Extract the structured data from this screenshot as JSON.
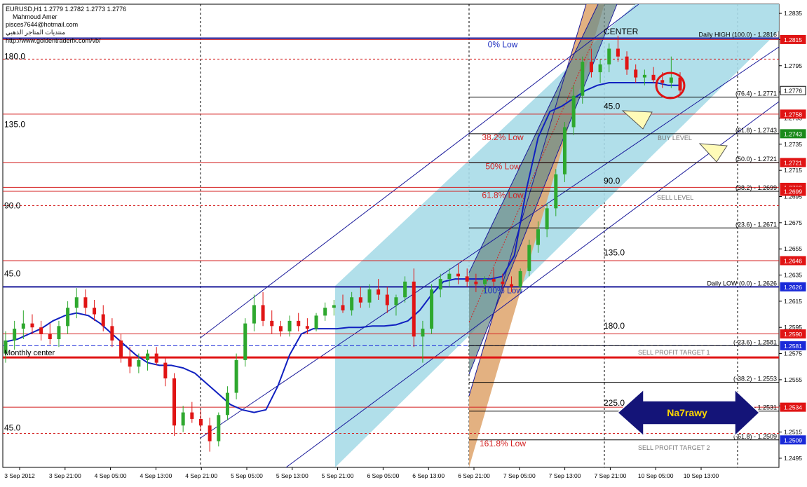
{
  "header": {
    "line1": "EURUSD,H1  1.2779 1.2782 1.2773 1.2776",
    "line2": "Mahmoud Amer",
    "line3": "pisces7644@hotmail.com",
    "line4": "منتديات المتاجر الذهبي",
    "line5": "http://www.goldentraderfx.com/vb/"
  },
  "colors": {
    "up": "#2ea82e",
    "down": "#e01414",
    "band": "#a9dbe8",
    "band_dark": "#6f8d8a",
    "band_orange": "#e0a873",
    "ma": "#1020c0",
    "red_line": "#d42020",
    "blue_line": "#1a1a9a",
    "arrow": "#141478"
  },
  "chart_data": {
    "type": "candlestick",
    "symbol": "EURUSD",
    "timeframe": "H1",
    "ylim": [
      1.2488,
      1.2842
    ],
    "y_ticks": [
      "1.2835",
      "1.2815",
      "1.2795",
      "1.2775",
      "1.2755",
      "1.2735",
      "1.2715",
      "1.2695",
      "1.2675",
      "1.2655",
      "1.2635",
      "1.2615",
      "1.2595",
      "1.2575",
      "1.2555",
      "1.2535",
      "1.2515",
      "1.2495"
    ],
    "x_ticks": [
      "3 Sep 2012",
      "3 Sep 21:00",
      "4 Sep 05:00",
      "4 Sep 13:00",
      "4 Sep 21:00",
      "5 Sep 05:00",
      "5 Sep 13:00",
      "5 Sep 21:00",
      "6 Sep 05:00",
      "6 Sep 13:00",
      "6 Sep 21:00",
      "7 Sep 05:00",
      "7 Sep 13:00",
      "7 Sep 21:00",
      "10 Sep 05:00",
      "10 Sep 13:00"
    ],
    "ohlc": [
      [
        1.2575,
        1.2592,
        1.2568,
        1.2585
      ],
      [
        1.2585,
        1.26,
        1.2578,
        1.2594
      ],
      [
        1.2594,
        1.2608,
        1.2586,
        1.2598
      ],
      [
        1.2598,
        1.2605,
        1.259,
        1.2595
      ],
      [
        1.2595,
        1.26,
        1.2585,
        1.259
      ],
      [
        1.259,
        1.2598,
        1.2582,
        1.2586
      ],
      [
        1.2586,
        1.26,
        1.258,
        1.2596
      ],
      [
        1.2596,
        1.2615,
        1.259,
        1.261
      ],
      [
        1.261,
        1.2625,
        1.2602,
        1.2618
      ],
      [
        1.2618,
        1.2624,
        1.2605,
        1.261
      ],
      [
        1.261,
        1.2616,
        1.26,
        1.2605
      ],
      [
        1.2605,
        1.2612,
        1.2592,
        1.2596
      ],
      [
        1.2596,
        1.2602,
        1.258,
        1.2585
      ],
      [
        1.2585,
        1.259,
        1.2568,
        1.2572
      ],
      [
        1.2572,
        1.258,
        1.256,
        1.2565
      ],
      [
        1.2565,
        1.2575,
        1.256,
        1.257
      ],
      [
        1.257,
        1.2578,
        1.2562,
        1.2575
      ],
      [
        1.2575,
        1.258,
        1.2566,
        1.2568
      ],
      [
        1.2568,
        1.2572,
        1.255,
        1.2556
      ],
      [
        1.2556,
        1.256,
        1.2512,
        1.252
      ],
      [
        1.252,
        1.2535,
        1.2515,
        1.253
      ],
      [
        1.253,
        1.2538,
        1.2522,
        1.2525
      ],
      [
        1.2525,
        1.2532,
        1.2516,
        1.252
      ],
      [
        1.252,
        1.2526,
        1.25,
        1.2508
      ],
      [
        1.2508,
        1.253,
        1.2504,
        1.2528
      ],
      [
        1.2528,
        1.255,
        1.2524,
        1.2545
      ],
      [
        1.2545,
        1.2575,
        1.254,
        1.257
      ],
      [
        1.257,
        1.2602,
        1.2565,
        1.2598
      ],
      [
        1.2598,
        1.262,
        1.2592,
        1.2612
      ],
      [
        1.2612,
        1.2622,
        1.2596,
        1.26
      ],
      [
        1.26,
        1.2608,
        1.259,
        1.2596
      ],
      [
        1.2596,
        1.26,
        1.2588,
        1.2592
      ],
      [
        1.2592,
        1.2604,
        1.2588,
        1.26
      ],
      [
        1.26,
        1.2606,
        1.2592,
        1.2596
      ],
      [
        1.2596,
        1.2602,
        1.259,
        1.2594
      ],
      [
        1.2594,
        1.2606,
        1.2592,
        1.2604
      ],
      [
        1.2604,
        1.2614,
        1.26,
        1.261
      ],
      [
        1.261,
        1.2616,
        1.2604,
        1.2612
      ],
      [
        1.2612,
        1.262,
        1.2606,
        1.2608
      ],
      [
        1.2608,
        1.2622,
        1.2604,
        1.2618
      ],
      [
        1.2618,
        1.2626,
        1.261,
        1.2614
      ],
      [
        1.2614,
        1.2628,
        1.261,
        1.2624
      ],
      [
        1.2624,
        1.2632,
        1.2616,
        1.262
      ],
      [
        1.262,
        1.2626,
        1.2606,
        1.2612
      ],
      [
        1.2612,
        1.262,
        1.2604,
        1.2618
      ],
      [
        1.2618,
        1.2634,
        1.2614,
        1.263
      ],
      [
        1.263,
        1.264,
        1.258,
        1.2588
      ],
      [
        1.2588,
        1.26,
        1.2568,
        1.2594
      ],
      [
        1.2594,
        1.2628,
        1.259,
        1.2624
      ],
      [
        1.2624,
        1.2636,
        1.2618,
        1.2632
      ],
      [
        1.2632,
        1.264,
        1.2626,
        1.2636
      ],
      [
        1.2636,
        1.2644,
        1.2628,
        1.2634
      ],
      [
        1.2634,
        1.264,
        1.2626,
        1.263
      ],
      [
        1.263,
        1.2636,
        1.2622,
        1.2628
      ],
      [
        1.2628,
        1.2634,
        1.2622,
        1.2632
      ],
      [
        1.2632,
        1.264,
        1.2626,
        1.263
      ],
      [
        1.263,
        1.2636,
        1.2624,
        1.2628
      ],
      [
        1.2628,
        1.2634,
        1.2622,
        1.2626
      ],
      [
        1.2626,
        1.264,
        1.2622,
        1.2638
      ],
      [
        1.2638,
        1.2662,
        1.2634,
        1.2658
      ],
      [
        1.2658,
        1.2676,
        1.2652,
        1.267
      ],
      [
        1.267,
        1.269,
        1.2664,
        1.2686
      ],
      [
        1.2686,
        1.2716,
        1.268,
        1.2712
      ],
      [
        1.2712,
        1.2752,
        1.2706,
        1.2748
      ],
      [
        1.2748,
        1.278,
        1.2742,
        1.2772
      ],
      [
        1.2772,
        1.2802,
        1.2766,
        1.2798
      ],
      [
        1.2798,
        1.2808,
        1.2786,
        1.279
      ],
      [
        1.279,
        1.28,
        1.2782,
        1.2796
      ],
      [
        1.2796,
        1.2812,
        1.279,
        1.2808
      ],
      [
        1.2808,
        1.2818,
        1.2798,
        1.2802
      ],
      [
        1.2802,
        1.2806,
        1.2788,
        1.2792
      ],
      [
        1.2792,
        1.2796,
        1.2782,
        1.2786
      ],
      [
        1.2786,
        1.2792,
        1.278,
        1.2788
      ],
      [
        1.2788,
        1.2794,
        1.2782,
        1.2784
      ],
      [
        1.2784,
        1.279,
        1.2778,
        1.2782
      ],
      [
        1.2782,
        1.2802,
        1.2778,
        1.2786
      ],
      [
        1.2786,
        1.279,
        1.2772,
        1.2776
      ]
    ],
    "ma_line": [
      1.2584,
      1.2586,
      1.259,
      1.2594,
      1.26,
      1.2604,
      1.2606,
      1.2604,
      1.2598,
      1.259,
      1.2582,
      1.2574,
      1.2568,
      1.2566,
      1.2566,
      1.2564,
      1.256,
      1.2552,
      1.2544,
      1.2536,
      1.2532,
      1.253,
      1.2532,
      1.255,
      1.2574,
      1.259,
      1.2594,
      1.2594,
      1.2594,
      1.2595,
      1.2595,
      1.2596,
      1.2596,
      1.2597,
      1.26,
      1.2608,
      1.262,
      1.263,
      1.2632,
      1.2632,
      1.2632,
      1.2632,
      1.2634,
      1.265,
      1.27,
      1.274,
      1.276,
      1.2764,
      1.277,
      1.2776,
      1.278,
      1.2782,
      1.2782,
      1.2782,
      1.2782,
      1.2782,
      1.278,
      1.278
    ],
    "levels": [
      {
        "label": "Daily HIGH (100.0) - 1.2816",
        "price": 1.2816,
        "color": "#1a1a9a",
        "width": 2
      },
      {
        "label": "(76.4) - 1.2771",
        "price": 1.2771,
        "color": "#000000",
        "width": 1
      },
      {
        "label": "(61.8) - 1.2743",
        "price": 1.2743,
        "color": "#000000",
        "width": 1
      },
      {
        "label": "(50.0) - 1.2721",
        "price": 1.2721,
        "color": "#000000",
        "width": 1
      },
      {
        "label": "(38.2) - 1.2699",
        "price": 1.2699,
        "color": "#000000",
        "width": 1
      },
      {
        "label": "(23.6) - 1.2671",
        "price": 1.2671,
        "color": "#000000",
        "width": 1
      },
      {
        "label": "Daily LOW (0.0) - 1.2626",
        "price": 1.2626,
        "color": "#1a1a9a",
        "width": 2
      },
      {
        "label": "(-23.6) - 1.2581",
        "price": 1.2581,
        "color": "#000000",
        "width": 1
      },
      {
        "label": "(-38.2) - 1.2553",
        "price": 1.2553,
        "color": "#000000",
        "width": 1
      },
      {
        "label": "(-51.8) - 1.2531",
        "price": 1.2531,
        "color": "#000000",
        "width": 1
      },
      {
        "label": "(-61.8) - 1.2509",
        "price": 1.2509,
        "color": "#000000",
        "width": 1
      }
    ],
    "price_tags": [
      {
        "label": "1.2815",
        "price": 1.2815,
        "color": "#e01414"
      },
      {
        "label": "1.2776",
        "price": 1.2776,
        "color": "#ffffff",
        "text_color": "#000000"
      },
      {
        "label": "1.2758",
        "price": 1.2758,
        "color": "#e01414"
      },
      {
        "label": "1.2743",
        "price": 1.2743,
        "color": "#1a8a1a"
      },
      {
        "label": "1.2721",
        "price": 1.2721,
        "color": "#e01414"
      },
      {
        "label": "1.2702",
        "price": 1.2702,
        "color": "#e01414"
      },
      {
        "label": "1.2699",
        "price": 1.2699,
        "color": "#e01414"
      },
      {
        "label": "1.2646",
        "price": 1.2646,
        "color": "#e01414"
      },
      {
        "label": "1.2626",
        "price": 1.2626,
        "color": "#1a2ad8"
      },
      {
        "label": "1.2590",
        "price": 1.259,
        "color": "#e01414"
      },
      {
        "label": "1.2581",
        "price": 1.2581,
        "color": "#1a2ad8"
      },
      {
        "label": "1.2534",
        "price": 1.2534,
        "color": "#e01414"
      },
      {
        "label": "1.2509",
        "price": 1.2509,
        "color": "#1a2ad8"
      }
    ],
    "fib_low_labels": [
      {
        "label": "0% Low",
        "price": 1.2809,
        "color": "#2030c0"
      },
      {
        "label": "38.2% Low",
        "price": 1.2738,
        "color": "#d42020"
      },
      {
        "label": "50% Low",
        "price": 1.2716,
        "color": "#d42020"
      },
      {
        "label": "61.8% Low",
        "price": 1.2694,
        "color": "#d42020"
      },
      {
        "label": "100% Low",
        "price": 1.2621,
        "color": "#2030c0"
      },
      {
        "label": "161.8% Low",
        "price": 1.2504,
        "color": "#d42020"
      }
    ],
    "gann_angles": [
      {
        "label": "180.0",
        "price": 1.28,
        "side": "left"
      },
      {
        "label": "135.0",
        "price": 1.2748,
        "side": "left"
      },
      {
        "label": "90.0",
        "price": 1.2686,
        "side": "left"
      },
      {
        "label": "45.0",
        "price": 1.2634,
        "side": "left"
      },
      {
        "label": "45.0",
        "price": 1.2516,
        "side": "left"
      },
      {
        "label": "45.0",
        "price": 1.2762,
        "side": "right"
      },
      {
        "label": "90.0",
        "price": 1.2705,
        "side": "right"
      },
      {
        "label": "135.0",
        "price": 1.265,
        "side": "right"
      },
      {
        "label": "180.0",
        "price": 1.2594,
        "side": "right"
      },
      {
        "label": "225.0",
        "price": 1.2535,
        "side": "right"
      }
    ],
    "annotations": {
      "center": "CENTER",
      "buy_level": "BUY LEVEL",
      "sell_level": "SELL LEVEL",
      "sell_target_1": "SELL PROFIT TARGET 1",
      "sell_target_2": "SELL PROFIT TARGET 2",
      "monthly_center": "Monthly center",
      "name_tag": "Na7rawy"
    }
  }
}
